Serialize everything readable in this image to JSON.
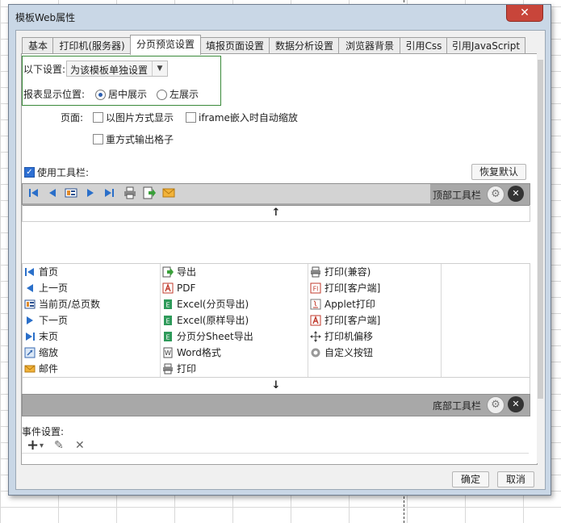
{
  "window": {
    "title": "模板Web属性",
    "close_glyph": "✕"
  },
  "tabs": [
    {
      "label": "基本",
      "active": false
    },
    {
      "label": "打印机(服务器)",
      "active": false
    },
    {
      "label": "分页预览设置",
      "active": true
    },
    {
      "label": "填报页面设置",
      "active": false
    },
    {
      "label": "数据分析设置",
      "active": false
    },
    {
      "label": "浏览器背景",
      "active": false
    },
    {
      "label": "引用Css",
      "active": false
    },
    {
      "label": "引用JavaScript",
      "active": false
    }
  ],
  "settings": {
    "scope_label": "以下设置:",
    "scope_value": "为该模板单独设置",
    "position_label": "报表显示位置:",
    "position_options": [
      "居中展示",
      "左展示"
    ],
    "position_selected": "居中展示",
    "page_label": "页面:",
    "options": [
      {
        "label": "以图片方式显示",
        "checked": false
      },
      {
        "label": "iframe嵌入时自动缩放",
        "checked": false
      },
      {
        "label": "重方式输出格子",
        "checked": false
      }
    ]
  },
  "toolbar": {
    "use_label": "使用工具栏:",
    "use_checked": true,
    "restore_label": "恢复默认",
    "top_label": "顶部工具栏",
    "bottom_label": "底部工具栏",
    "top_icons": [
      "first-page-icon",
      "prev-page-icon",
      "page-number-icon",
      "next-page-icon",
      "last-page-icon",
      "print-icon",
      "export-icon",
      "email-icon"
    ],
    "up_arrow": "↑",
    "down_arrow": "↓"
  },
  "buttons_grid": {
    "col1": [
      "首页",
      "上一页",
      "当前页/总页数",
      "下一页",
      "末页",
      "缩放",
      "邮件"
    ],
    "col2": [
      "导出",
      "PDF",
      "Excel(分页导出)",
      "Excel(原样导出)",
      "分页分Sheet导出",
      "Word格式",
      "打印"
    ],
    "col3": [
      "打印(兼容)",
      "打印[客户端]",
      "Applet打印",
      "打印[客户端]",
      "打印机偏移",
      "自定义按钮"
    ]
  },
  "events": {
    "label": "事件设置:",
    "add_glyph": "+",
    "dropdown_glyph": "▾",
    "edit_glyph": "✎",
    "delete_glyph": "✕"
  },
  "footer": {
    "ok_label": "确定",
    "cancel_label": "取消"
  }
}
